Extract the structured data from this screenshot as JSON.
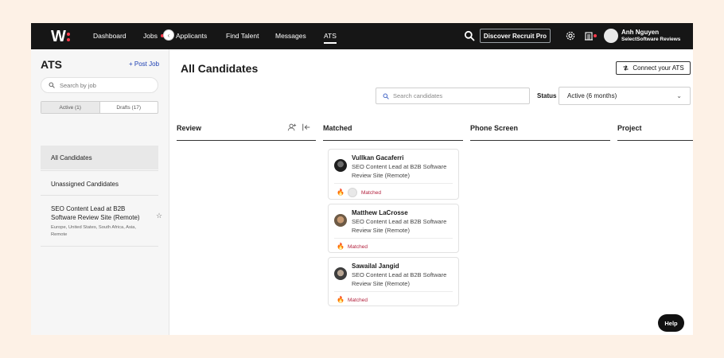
{
  "brand": {
    "logo_letter": "W",
    "accent": "#ff3b4b"
  },
  "nav": {
    "items": [
      {
        "label": "Dashboard"
      },
      {
        "label": "Jobs"
      },
      {
        "label": "Applicants"
      },
      {
        "label": "Find Talent"
      },
      {
        "label": "Messages"
      },
      {
        "label": "ATS"
      }
    ],
    "active": "ATS",
    "discover_label": "Discover Recruit Pro",
    "user_name": "Anh Nguyen",
    "user_company": "SelectSoftware Reviews",
    "icons": [
      "search-icon",
      "gear-icon",
      "building-icon"
    ]
  },
  "sidebar": {
    "title": "ATS",
    "post_job": "+ Post Job",
    "search_placeholder": "Search by job",
    "tabs": {
      "active": "Active (1)",
      "drafts": "Drafts (17)"
    },
    "items": [
      {
        "label": "All Candidates"
      },
      {
        "label": "Unassigned Candidates"
      }
    ],
    "job": {
      "title": "SEO Content Lead at B2B Software Review Site (Remote)",
      "locations": "Europe, United States, South Africa, Asia, Remote"
    }
  },
  "main": {
    "title": "All Candidates",
    "connect_label": "Connect your ATS",
    "search_placeholder": "Search candidates",
    "status_label": "Status",
    "status_value": "Active (6 months)",
    "columns": [
      {
        "label": "Review"
      },
      {
        "label": "Matched"
      },
      {
        "label": "Phone Screen"
      },
      {
        "label": "Project"
      }
    ],
    "cards": [
      {
        "name": "Vullkan Gacaferri",
        "role": "SEO Content Lead at B2B Software Review Site (Remote)",
        "status": "Matched"
      },
      {
        "name": "Matthew LaCrosse",
        "role": "SEO Content Lead at B2B Software Review Site (Remote)",
        "status": "Matched"
      },
      {
        "name": "Sawailal Jangid",
        "role": "SEO Content Lead at B2B Software Review Site (Remote)",
        "status": "Matched"
      }
    ],
    "help_label": "Help"
  }
}
